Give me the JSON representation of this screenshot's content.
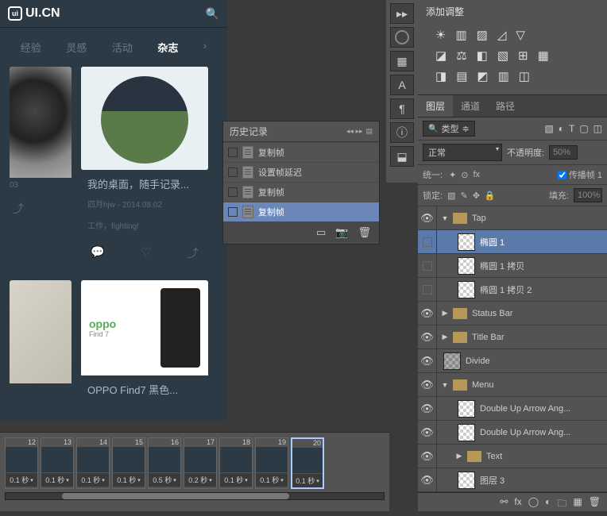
{
  "browser": {
    "logo": "UI.CN",
    "nav": [
      "经验",
      "灵感",
      "活动",
      "杂志"
    ],
    "nav_active": 3,
    "nav_arrow": "›",
    "card1": {
      "title": "我的桌面，随手记录...",
      "meta": "四月hjw - 2014.08.02",
      "desc": "工作，fighting!",
      "side_meta": "03"
    },
    "card2": {
      "oppo_brand": "oppo",
      "oppo_model": "Find 7",
      "title": "OPPO Find7 黑色..."
    }
  },
  "history": {
    "title": "历史记录",
    "items": [
      "复制帧",
      "设置帧延迟",
      "复制帧",
      "复制帧"
    ],
    "selected": 3
  },
  "adjustments": {
    "title": "添加调整"
  },
  "layerpanel": {
    "tabs": [
      "图层",
      "通道",
      "路径"
    ],
    "active_tab": 0,
    "type_label": "类型",
    "mode": "正常",
    "opacity_label": "不透明度:",
    "opacity_val": "50%",
    "unify_label": "统一:",
    "propagate": "传播帧 1",
    "lock_label": "锁定:",
    "fill_label": "填充:",
    "fill_val": "100%"
  },
  "layers": [
    {
      "eye": true,
      "indent": 0,
      "type": "folder",
      "toggle": "▼",
      "name": "Tap"
    },
    {
      "eye": false,
      "indent": 1,
      "type": "layer",
      "thumb": "ck",
      "name": "椭圆 1",
      "sel": true
    },
    {
      "eye": false,
      "indent": 1,
      "type": "layer",
      "thumb": "ck",
      "name": "椭圆 1 拷贝"
    },
    {
      "eye": false,
      "indent": 1,
      "type": "layer",
      "thumb": "ck",
      "name": "椭圆 1 拷贝 2"
    },
    {
      "eye": true,
      "indent": 0,
      "type": "folder",
      "toggle": "▶",
      "name": "Status Bar"
    },
    {
      "eye": true,
      "indent": 0,
      "type": "folder",
      "toggle": "▶",
      "name": "Title Bar"
    },
    {
      "eye": true,
      "indent": 0,
      "type": "layer",
      "thumb": "ck2",
      "name": "Divide"
    },
    {
      "eye": true,
      "indent": 0,
      "type": "folder",
      "toggle": "▼",
      "name": "Menu"
    },
    {
      "eye": true,
      "indent": 1,
      "type": "layer",
      "thumb": "ck",
      "name": "Double Up Arrow Ang..."
    },
    {
      "eye": true,
      "indent": 1,
      "type": "layer",
      "thumb": "ck",
      "name": "Double Up Arrow Ang..."
    },
    {
      "eye": true,
      "indent": 1,
      "type": "folder",
      "toggle": "▶",
      "name": "Text"
    },
    {
      "eye": true,
      "indent": 1,
      "type": "layer",
      "thumb": "ck",
      "name": "图层 3"
    }
  ],
  "timeline": {
    "frames": [
      {
        "n": 12,
        "d": "0.1 秒"
      },
      {
        "n": 13,
        "d": "0.1 秒"
      },
      {
        "n": 14,
        "d": "0.1 秒"
      },
      {
        "n": 15,
        "d": "0.1 秒"
      },
      {
        "n": 16,
        "d": "0.5 秒"
      },
      {
        "n": 17,
        "d": "0.2 秒"
      },
      {
        "n": 18,
        "d": "0.1 秒"
      },
      {
        "n": 19,
        "d": "0.1 秒"
      },
      {
        "n": 20,
        "d": "0.1 秒"
      }
    ],
    "selected": 8
  }
}
